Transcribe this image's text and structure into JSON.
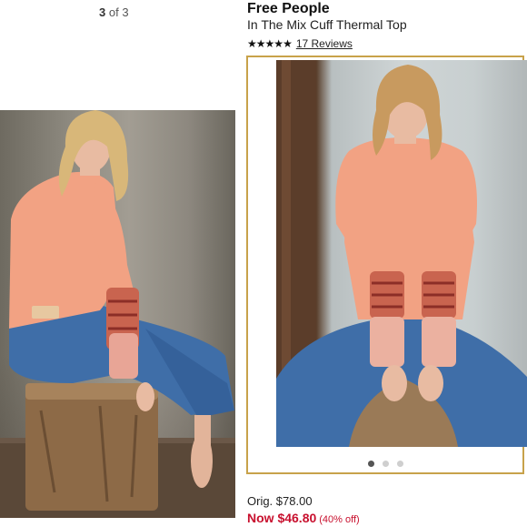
{
  "gallery": {
    "current": "3",
    "separator": "of",
    "total": "3"
  },
  "product": {
    "brand": "Free People",
    "name": "In The Mix Cuff Thermal Top",
    "rating": 4.5,
    "reviews_label": "17 Reviews"
  },
  "carousel": {
    "dots": 3,
    "active_index": 0
  },
  "pricing": {
    "orig_label": "Orig. $78.00",
    "now_label": "Now $46.80",
    "discount_label": "(40% off)"
  },
  "colors": {
    "accent_border": "#c8a24a",
    "sale_red": "#c8102e",
    "top_peach": "#f2a283",
    "denim": "#3f6ea8"
  }
}
